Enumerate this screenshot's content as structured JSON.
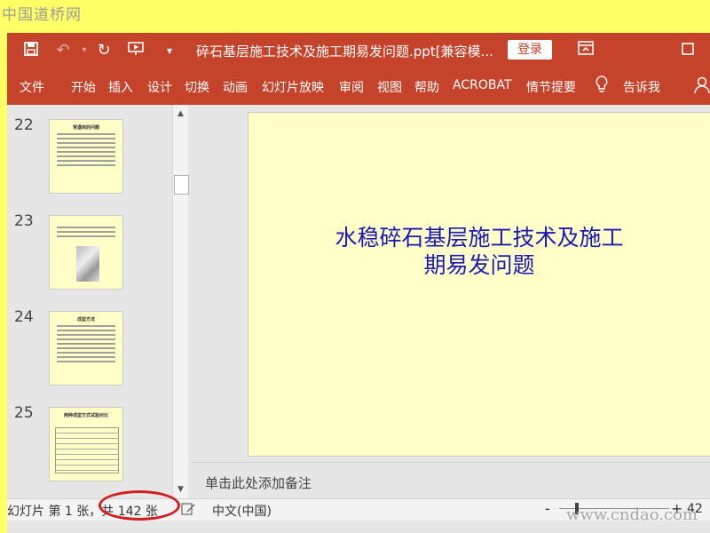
{
  "watermark": {
    "site_cn": "中国道桥网",
    "site_url": "www.cndao.com"
  },
  "titlebar": {
    "title": "碎石基层施工技术及施工期易发问题.ppt[兼容模...",
    "login_label": "登录",
    "icons": [
      "save-icon",
      "undo-icon",
      "redo-icon",
      "slideshow-from-start-icon",
      "customize-toolbar-icon",
      "ribbon-display-options-icon",
      "maximize-icon"
    ]
  },
  "ribbon": {
    "tabs": [
      "文件",
      "开始",
      "插入",
      "设计",
      "切换",
      "动画",
      "幻灯片放映",
      "审阅",
      "视图",
      "帮助",
      "ACROBAT",
      "情节提要"
    ],
    "tell_me": "告诉我"
  },
  "thumbnails": [
    {
      "number": "22",
      "caption": "常遇到的问题"
    },
    {
      "number": "23",
      "caption": ""
    },
    {
      "number": "24",
      "caption": "成型方法"
    },
    {
      "number": "25",
      "caption": "两种成型方式试验对比"
    }
  ],
  "slide": {
    "title_line1": "水稳碎石基层施工技术及施工",
    "title_line2": "期易发问题",
    "title_color": "#1a1ab8",
    "background": "#ffffc8"
  },
  "notes": {
    "placeholder": "单击此处添加备注"
  },
  "status": {
    "slide_count": "幻灯片 第 1 张，共 142 张",
    "language": "中文(中国)",
    "zoom_minus": "-",
    "zoom_plus": "+",
    "zoom_level": "42"
  },
  "colors": {
    "accent": "#c5432b",
    "highlight": "#d21e1e",
    "page_border": "#ffff66"
  }
}
